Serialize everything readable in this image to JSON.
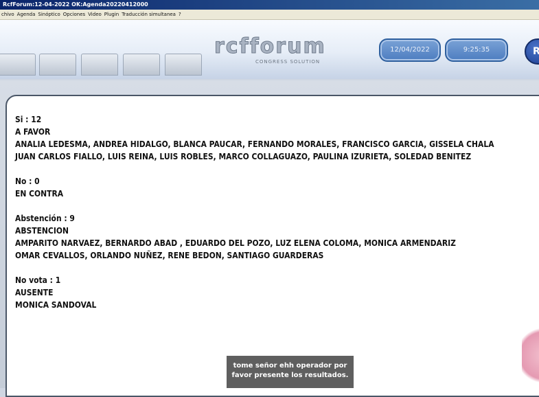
{
  "window": {
    "title": "RcfForum:12-04-2022 OK:Agenda20220412000"
  },
  "menu": [
    "chivo",
    "Agenda",
    "Sinóptico",
    "Opciones",
    "Video",
    "Plugin",
    "Traducción simultanea",
    "?"
  ],
  "header": {
    "logo": "rcfforum",
    "logo_sub": "CONGRESS SOLUTION",
    "date": "12/04/2022",
    "time": "9:25:35",
    "right_button": "R"
  },
  "results": {
    "si": {
      "count_line": "Si : 12",
      "label": "A FAVOR",
      "names": [
        "ANALIA LEDESMA, ANDREA HIDALGO, BLANCA PAUCAR, FERNANDO MORALES, FRANCISCO GARCIA, GISSELA CHALA",
        "JUAN CARLOS FIALLO, LUIS REINA, LUIS ROBLES, MARCO COLLAGUAZO, PAULINA IZURIETA, SOLEDAD BENITEZ"
      ]
    },
    "no": {
      "count_line": "No : 0",
      "label": "EN CONTRA"
    },
    "abstencion": {
      "count_line": "Abstención : 9",
      "label": "ABSTENCION",
      "names": [
        "AMPARITO NARVAEZ, BERNARDO ABAD , EDUARDO DEL POZO, LUZ ELENA COLOMA, MONICA ARMENDARIZ",
        "OMAR CEVALLOS, ORLANDO NUÑEZ, RENE BEDON, SANTIAGO GUARDERAS"
      ]
    },
    "no_vota": {
      "count_line": "No vota : 1",
      "label": "AUSENTE",
      "names": [
        "MONICA SANDOVAL"
      ]
    }
  },
  "subtitle": {
    "line1": "tome señor ehh operador por",
    "line2": "favor presente los resultados."
  }
}
